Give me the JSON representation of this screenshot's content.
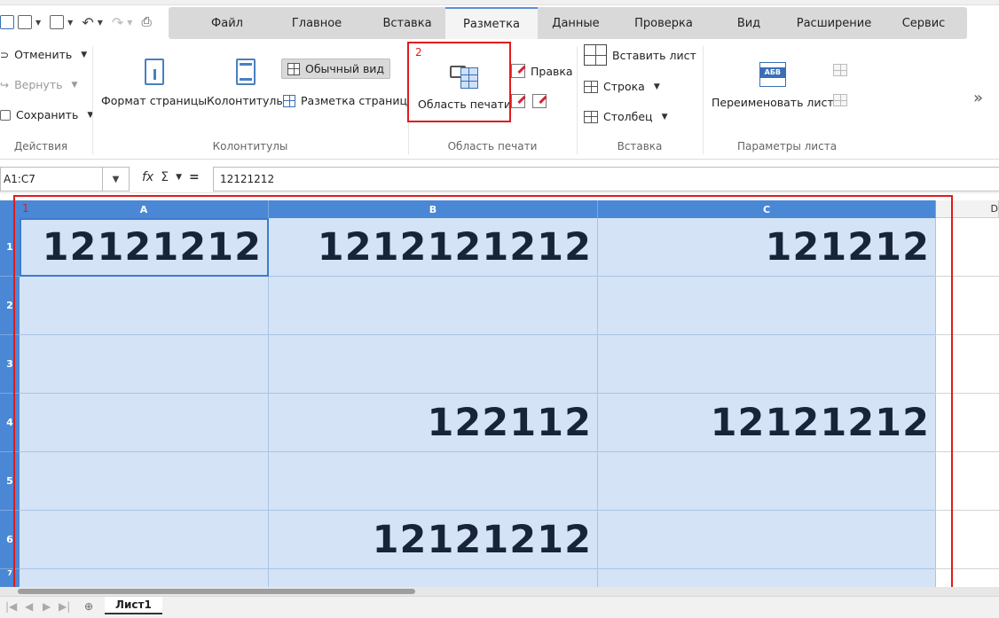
{
  "menu": {
    "tabs": [
      {
        "label": "Файл",
        "active": false
      },
      {
        "label": "Главное",
        "active": false
      },
      {
        "label": "Вставка",
        "active": false
      },
      {
        "label": "Разметка",
        "active": true
      },
      {
        "label": "Данные",
        "active": false
      },
      {
        "label": "Проверка",
        "active": false
      },
      {
        "label": "Вид",
        "active": false
      },
      {
        "label": "Расширение",
        "active": false
      },
      {
        "label": "Сервис",
        "active": false
      }
    ]
  },
  "ribbon": {
    "actions": {
      "undo_label": "Отменить",
      "redo_label": "Вернуть",
      "save_label": "Сохранить",
      "group_label": "Действия"
    },
    "headers": {
      "page_format_label": "Формат страницы",
      "headers_footers_label": "Колонтитулы",
      "normal_view_label": "Обычный вид",
      "page_layout_label": "Разметка страниц",
      "group_label": "Колонтитулы"
    },
    "print_area": {
      "print_area_label": "Область печати",
      "edit_label": "Правка",
      "group_label": "Область печати",
      "annotation_number": "2"
    },
    "insert": {
      "insert_sheet_label": "Вставить лист",
      "row_label": "Строка",
      "column_label": "Столбец",
      "group_label": "Вставка"
    },
    "sheet_params": {
      "rename_sheet_label": "Переименовать лист",
      "sheet_icon_text": "АБВ",
      "group_label": "Параметры листа"
    },
    "more_glyph": "»"
  },
  "formula_bar": {
    "name_box": "A1:C7",
    "fx_glyph": "fx",
    "sum_glyph": "Σ",
    "equals_glyph": "=",
    "formula_value": "12121212"
  },
  "sheet": {
    "annotation_number": "1",
    "columns": [
      "A",
      "B",
      "C",
      "D"
    ],
    "rows": [
      "1",
      "2",
      "3",
      "4",
      "5",
      "6",
      "7"
    ],
    "cells": [
      [
        "12121212",
        "1212121212",
        "121212"
      ],
      [
        "",
        "",
        ""
      ],
      [
        "",
        "",
        ""
      ],
      [
        "",
        "122112",
        "12121212"
      ],
      [
        "",
        "",
        ""
      ],
      [
        "",
        "12121212",
        ""
      ],
      [
        "",
        "",
        ""
      ]
    ],
    "tab_name": "Лист1"
  },
  "colors": {
    "accent": "#4a88d6",
    "selection_fill": "#d4e3f5",
    "annotation_red": "#e01b1b"
  }
}
